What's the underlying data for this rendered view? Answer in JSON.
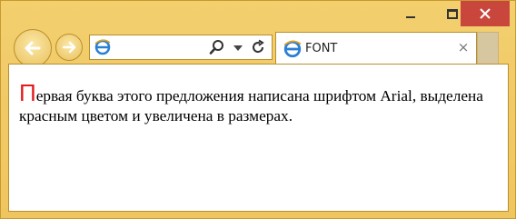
{
  "window": {
    "controls": {
      "minimize_icon": "minimize-icon",
      "maximize_icon": "maximize-icon",
      "close_icon": "close-icon"
    }
  },
  "navigation": {
    "back_icon": "back-arrow-icon",
    "forward_icon": "forward-arrow-icon"
  },
  "address_bar": {
    "value": "",
    "placeholder": "",
    "icons": [
      "ie-logo-icon",
      "search-icon",
      "dropdown-icon",
      "refresh-icon"
    ]
  },
  "tab": {
    "title": "FONT",
    "close_glyph": "×"
  },
  "page": {
    "first_letter": "П",
    "text": "ервая буква этого предложения написана шрифтом Arial, выделена красным цветом и увеличена в размерах."
  },
  "colors": {
    "frame": "#f0c75e",
    "close_button": "#c9463d",
    "first_letter": "#e21b1b",
    "ie_blue": "#2a7fd4"
  }
}
